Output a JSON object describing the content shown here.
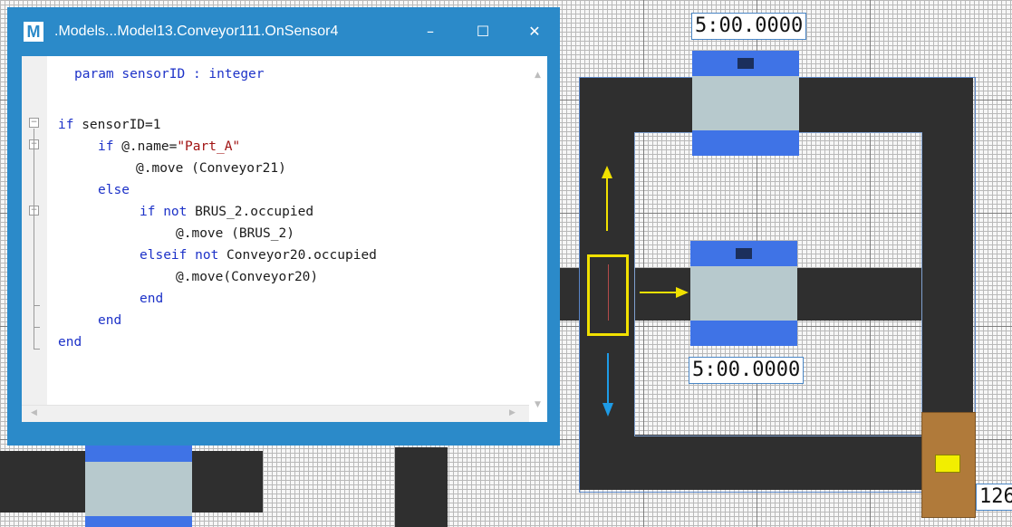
{
  "window": {
    "app_icon": "M",
    "title": ".Models...Model13.Conveyor111.OnSensor4",
    "minimize_glyph": "–",
    "maximize_glyph": "☐",
    "close_glyph": "✕"
  },
  "code": {
    "lines": {
      "l1": {
        "t1": "param sensorID : integer"
      },
      "l2": {
        "k1": "if",
        "t1": " sensorID=1"
      },
      "l3": {
        "k1": "if",
        "t1": " @.name=",
        "s1": "\"Part_A\""
      },
      "l4": {
        "t1": "@.move (Conveyor21)"
      },
      "l5": {
        "k1": "else"
      },
      "l6": {
        "k1": "if not",
        "t1": " BRUS_2.occupied"
      },
      "l7": {
        "t1": "@.move (BRUS_2)"
      },
      "l8": {
        "k1": "elseif not",
        "t1": " Conveyor20.occupied"
      },
      "l9": {
        "t1": "@.move(Conveyor20)"
      },
      "l10": {
        "k1": "end"
      },
      "l11": {
        "k1": "end"
      },
      "l12": {
        "k1": "end"
      }
    }
  },
  "simulation": {
    "timer_top": "5:00.0000",
    "timer_middle": "5:00.0000",
    "timer_bottom_right": "126"
  },
  "colors": {
    "conveyor": "#2f2f2f",
    "station_bar": "#3f73e6",
    "station_body": "#b7c9cd",
    "sensor_highlight": "#f1e100",
    "arrow_up_right": "#f1e100",
    "arrow_down": "#1e9be6",
    "store": "#b07a3a",
    "window_chrome": "#2b8ac9"
  }
}
